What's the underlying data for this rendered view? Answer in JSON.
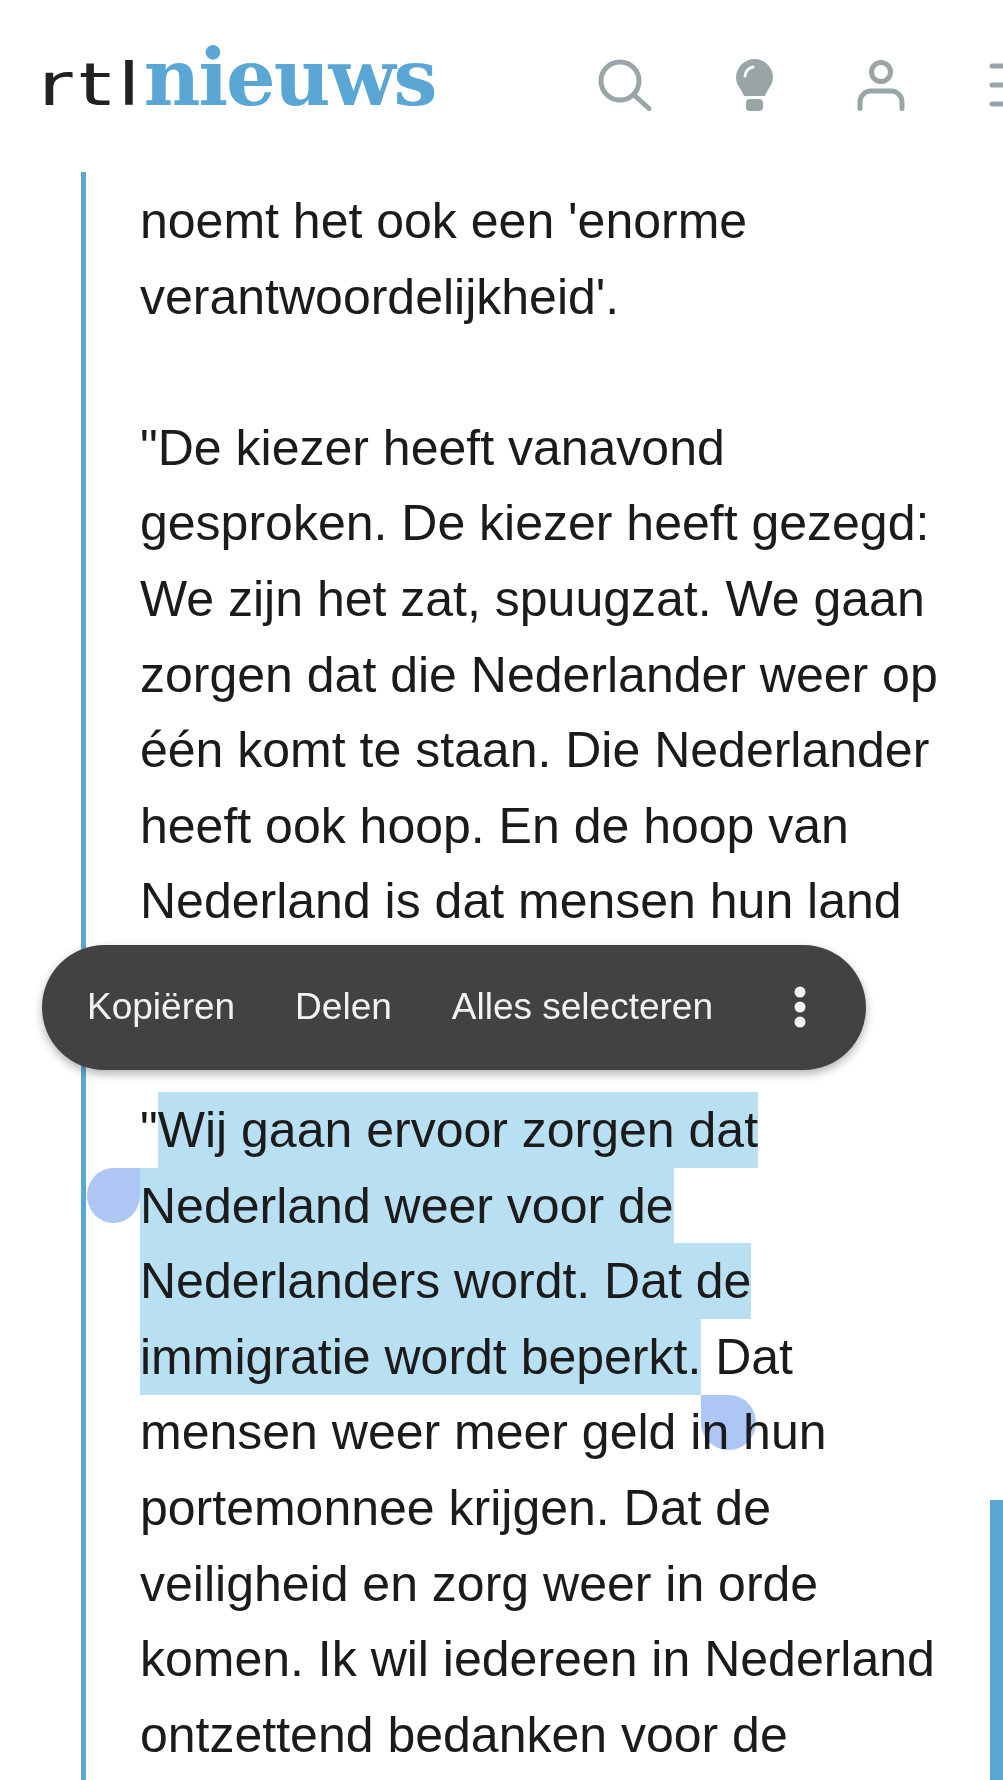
{
  "header": {
    "logo": {
      "mark": "rtl",
      "word": "nieuws"
    }
  },
  "article": {
    "blocks": [
      {
        "kind": "paragraph",
        "segments": [
          {
            "text": "noemt het ook een 'enorme verantwoordelijkheid'.",
            "selected": false
          }
        ]
      },
      {
        "kind": "paragraph",
        "segments": [
          {
            "text": "\"De kiezer heeft vanavond gesproken. De kiezer heeft gezegd: We zijn het zat, spuugzat. We gaan zorgen dat die Nederlander weer op één komt te staan. Die Nederlander heeft ook hoop. En de hoop van Nederland is dat mensen hun land",
            "selected": false
          }
        ]
      },
      {
        "kind": "selection_toolbar",
        "actions": [
          "Kopiëren",
          "Delen",
          "Alles selecteren"
        ]
      },
      {
        "kind": "paragraph",
        "segments": [
          {
            "text": "\"",
            "selected": false
          },
          {
            "text": "Wij gaan ervoor zorgen dat Nederland weer voor de Nederlanders wordt. Dat de immigratie wordt beperkt.",
            "selected": true
          },
          {
            "text": " Dat mensen weer meer geld in hun portemonnee krijgen. Dat de veiligheid en zorg weer in orde komen. Ik wil iedereen in Nederland ontzettend bedanken voor de",
            "selected": false
          }
        ]
      }
    ]
  }
}
